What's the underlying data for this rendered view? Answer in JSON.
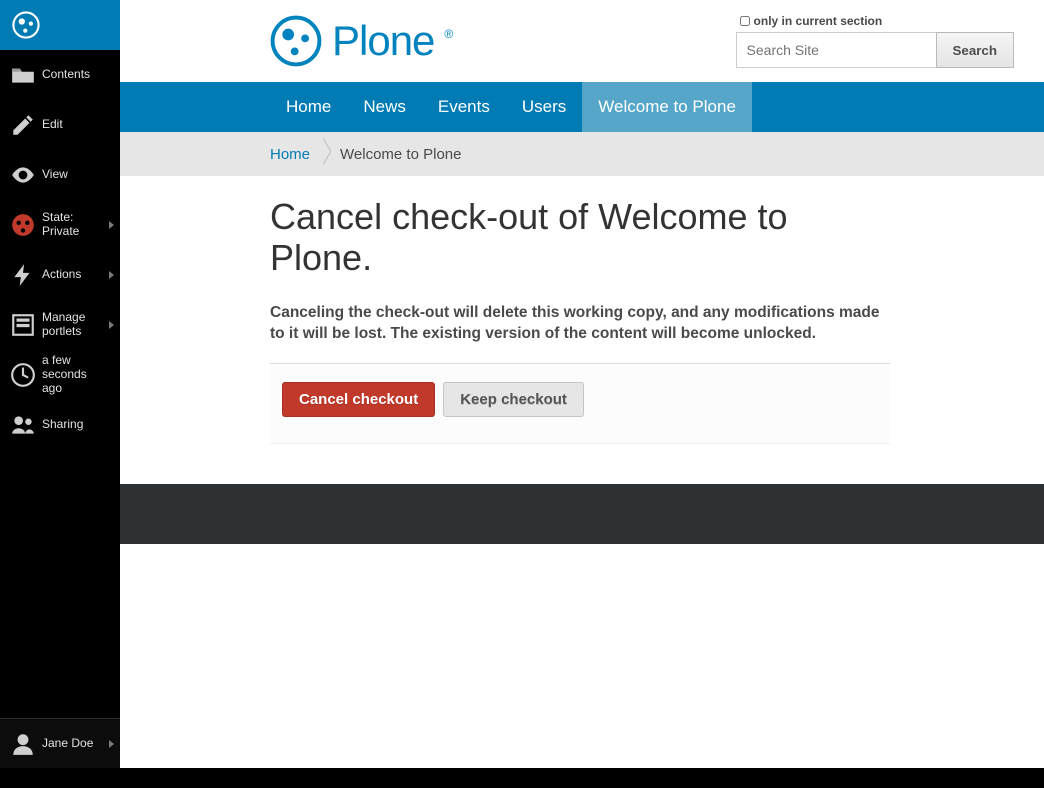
{
  "toolbar": {
    "items": [
      {
        "label": "Contents"
      },
      {
        "label": "Edit"
      },
      {
        "label": "View"
      },
      {
        "label": "State: Private"
      },
      {
        "label": "Actions"
      },
      {
        "label": "Manage portlets"
      },
      {
        "label": "a few seconds ago"
      },
      {
        "label": "Sharing"
      }
    ],
    "user": "Jane Doe"
  },
  "search": {
    "checkbox_label": "only in current section",
    "placeholder": "Search Site",
    "button": "Search"
  },
  "logo_text": "Plone",
  "nav": {
    "items": [
      "Home",
      "News",
      "Events",
      "Users",
      "Welcome to Plone"
    ],
    "active_index": 4
  },
  "breadcrumbs": {
    "home": "Home",
    "current": "Welcome to Plone"
  },
  "page": {
    "title": "Cancel check-out of Welcome to Plone.",
    "lead": "Canceling the check-out will delete this working copy, and any modifications made to it will be lost. The existing version of the content will become unlocked.",
    "cancel_button": "Cancel checkout",
    "keep_button": "Keep checkout"
  }
}
